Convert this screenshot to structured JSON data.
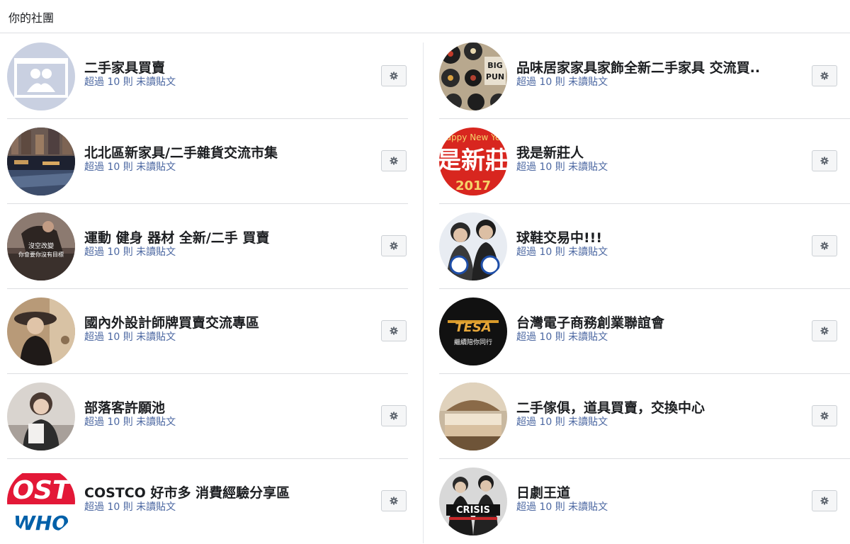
{
  "header": {
    "title": "你的社團"
  },
  "groups_left": [
    {
      "name": "二手家具買賣",
      "unread": "超過 10 則 未讀貼文",
      "avatar": "placeholder-avatar"
    },
    {
      "name": "北北區新家具/二手雜貨交流市集",
      "unread": "超過 10 則 未讀貼文",
      "avatar": "canal-city-avatar"
    },
    {
      "name": "運動 健身 器材 全新/二手 買賣",
      "unread": "超過 10 則 未讀貼文",
      "avatar": "fitness-avatar"
    },
    {
      "name": "國內外設計師牌買賣交流專區",
      "unread": "超過 10 則 未讀貼文",
      "avatar": "fashion-avatar"
    },
    {
      "name": "部落客許願池",
      "unread": "超過 10 則 未讀貼文",
      "avatar": "blogger-avatar"
    },
    {
      "name": "COSTCO 好市多 消費經驗分享區",
      "unread": "超過 10 則 未讀貼文",
      "avatar": "costco-avatar"
    }
  ],
  "groups_right": [
    {
      "name": "品味居家家具家飾全新二手家具 交流買..",
      "unread": "超過 10 則 未讀貼文",
      "avatar": "records-avatar"
    },
    {
      "name": "我是新莊人",
      "unread": "超過 10 則 未讀貼文",
      "avatar": "new-year-avatar"
    },
    {
      "name": "球鞋交易中!!!",
      "unread": "超過 10 則 未讀貼文",
      "avatar": "people-avatar"
    },
    {
      "name": "台灣電子商務創業聯誼會",
      "unread": "超過 10 則 未讀貼文",
      "avatar": "tesa-avatar"
    },
    {
      "name": "二手傢俱，道具買賣，交換中心",
      "unread": "超過 10 則 未讀貼文",
      "avatar": "bedroom-avatar"
    },
    {
      "name": "日劇王道",
      "unread": "超過 10 則 未讀貼文",
      "avatar": "drama-avatar"
    }
  ],
  "avatar_text": {
    "fitness": "沒空改變",
    "fitness_sub": "你會要你沒有目標",
    "big": "BIG",
    "pun": "PUN",
    "new_year": "appy New Ye",
    "xin": "是新莊",
    "year": "2017",
    "tesa": "TESA",
    "tesa_sub": "繼續陪你同行",
    "costco_1": "OST",
    "costco_2": "WHO",
    "crisis": "CRISIS"
  },
  "colors": {
    "link_blue": "#4b67a1",
    "divider": "#dddfe2",
    "button_bg": "#f5f6f7"
  }
}
